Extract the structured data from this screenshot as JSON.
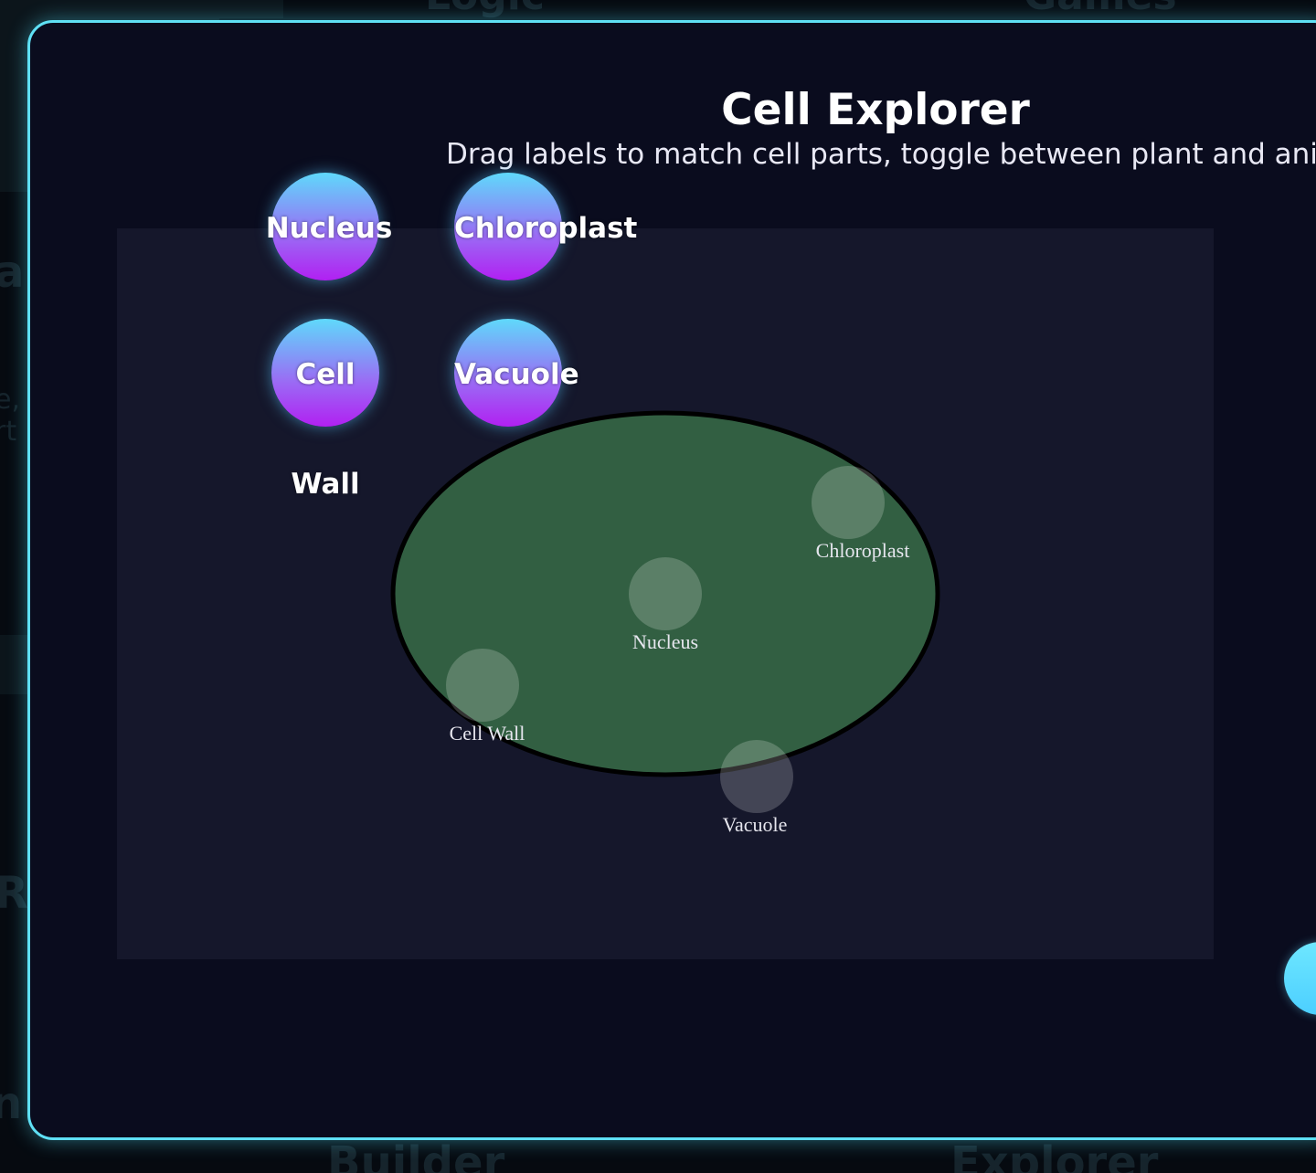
{
  "app": {
    "title": "Cell Explorer",
    "subtitle": "Drag labels to match cell parts, toggle between plant and animal."
  },
  "label_chips": [
    {
      "label": "Nucleus"
    },
    {
      "label": "Chloroplast"
    },
    {
      "label": "Cell"
    },
    {
      "label": "Vacuole"
    }
  ],
  "label_chip_overflow_text": "Wall",
  "cell_diagram": {
    "mode": "plant",
    "cell_fill_color": "#325f42",
    "outline_color": "#000000",
    "targets": [
      {
        "label": "Chloroplast"
      },
      {
        "label": "Nucleus"
      },
      {
        "label": "Cell Wall"
      },
      {
        "label": "Vacuole"
      }
    ]
  },
  "colors": {
    "accent_border": "#5fe0f5",
    "chip_gradient_top": "#5fd9fb",
    "chip_gradient_bottom": "#b120f2",
    "board_background": "#15172b",
    "modal_background": "#0a0c1e"
  },
  "background": {
    "fragments": [
      "Logic",
      "Games",
      "a",
      "e,",
      "rt",
      "R",
      "n",
      "Builder",
      "Explorer"
    ]
  }
}
